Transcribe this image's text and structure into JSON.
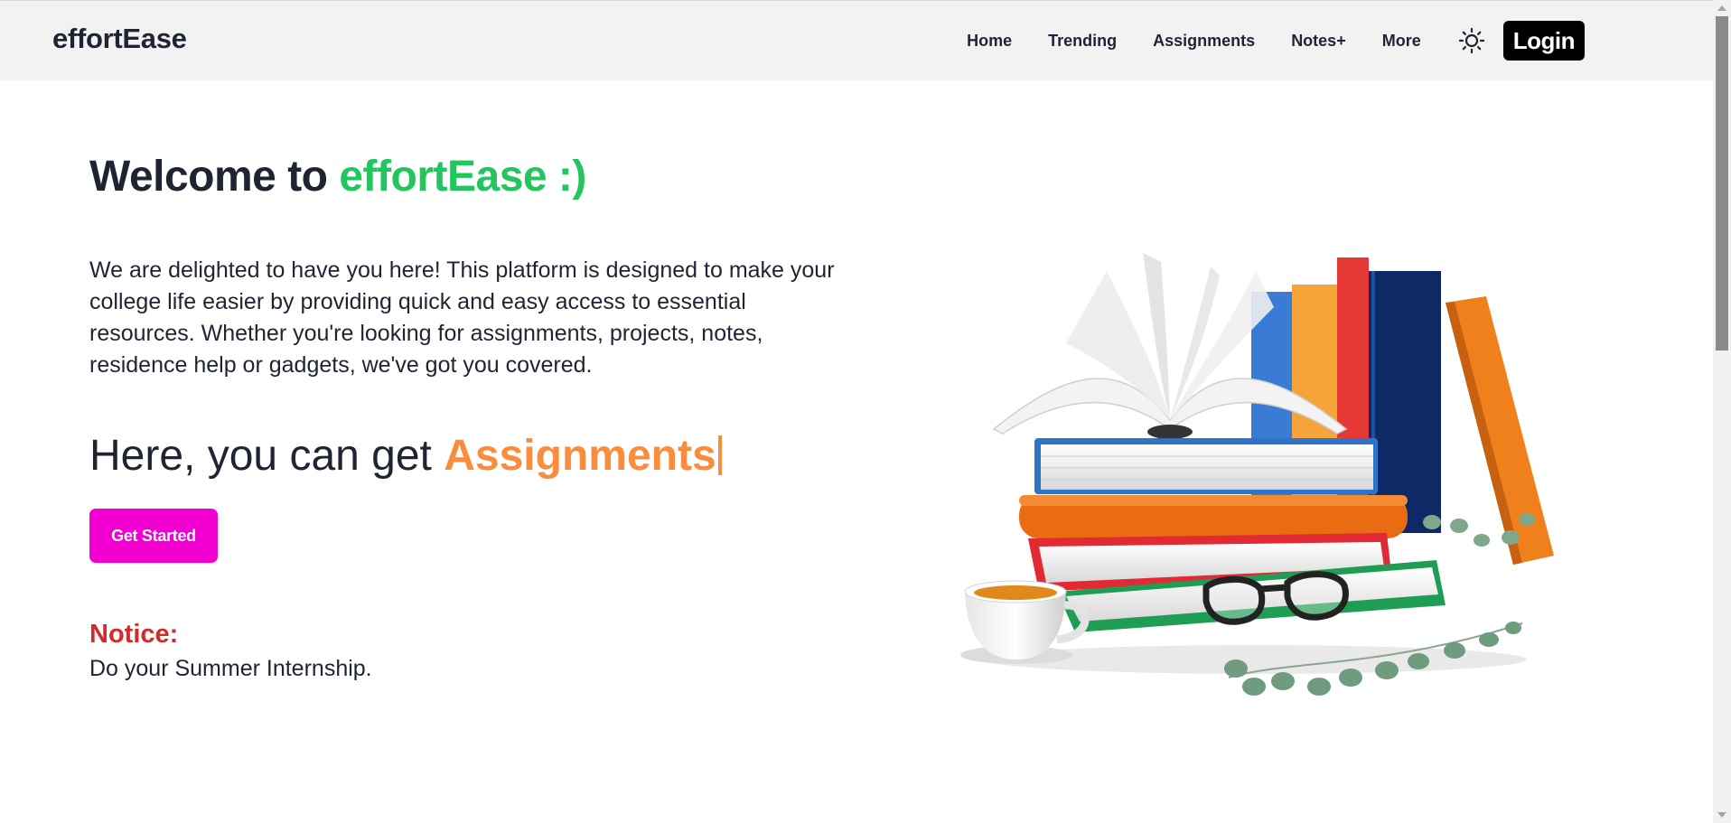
{
  "navbar": {
    "brand": "effortEase",
    "links": [
      {
        "label": "Home"
      },
      {
        "label": "Trending"
      },
      {
        "label": "Assignments"
      },
      {
        "label": "Notes+"
      },
      {
        "label": "More"
      }
    ],
    "theme_icon": "sun-icon",
    "login_label": "Login"
  },
  "hero": {
    "title_prefix": "Welcome to ",
    "title_accent": "effortEase :)",
    "intro": "We are delighted to have you here! This platform is designed to make your college life easier by providing quick and easy access to essential resources. Whether you're looking for assignments, projects, notes, residence help or gadgets, we've got you covered.",
    "typing_prefix": "Here, you can get ",
    "typing_word": "Assignments",
    "cta_label": "Get Started"
  },
  "notice": {
    "title": "Notice:",
    "text": "Do your Summer Internship."
  },
  "colors": {
    "brand_green": "#22c55e",
    "typing_orange": "#fb8c3c",
    "cta_magenta": "#f200d2",
    "notice_red": "#d42a2a",
    "navbar_bg": "#f2f2f2"
  },
  "illustration": {
    "icon": "books-stack-illustration"
  }
}
